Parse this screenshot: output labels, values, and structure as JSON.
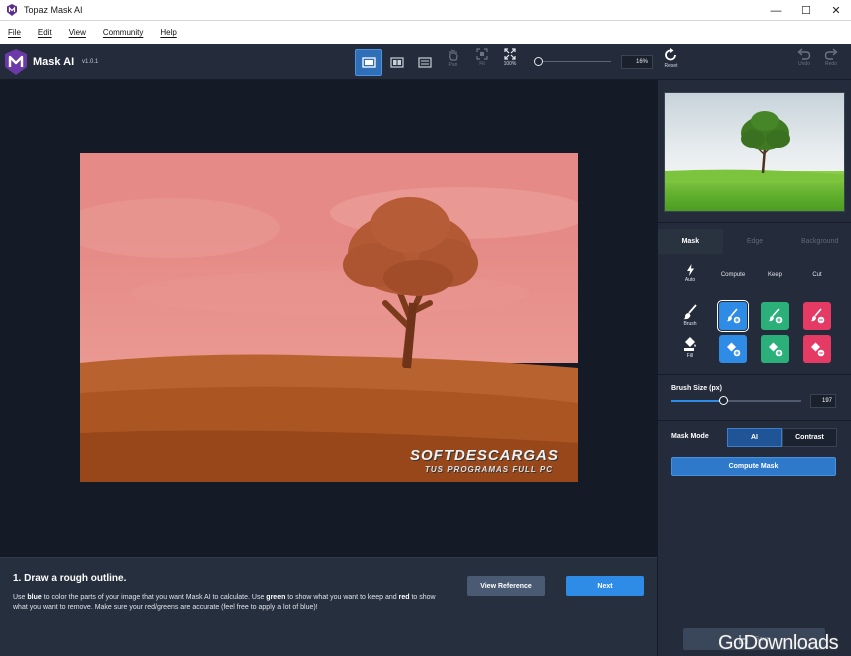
{
  "window": {
    "title": "Topaz Mask AI",
    "minimize": "—",
    "maximize": "☐",
    "close": "✕"
  },
  "menu": {
    "items": [
      "File",
      "Edit",
      "View",
      "Community",
      "Help"
    ]
  },
  "toolbar": {
    "app_name": "Mask AI",
    "version": "v1.0.1",
    "pan_label": "Pan",
    "fit_label": "Fit",
    "zoom100_label": "100%",
    "zoom_value": "16%",
    "zoom_fraction": 0.0,
    "reset_label": "Reset",
    "undo_label": "Undo",
    "redo_label": "Redo"
  },
  "canvas": {
    "watermark_title": "SOFTDESCARGAS",
    "watermark_subtitle": "TUS PROGRAMAS FULL PC"
  },
  "instructions": {
    "heading": "1. Draw a rough outline.",
    "text_1": "Use ",
    "blue": "blue",
    "text_2": " to color the parts of your image that you want Mask AI to calculate. Use ",
    "green": "green",
    "text_3": " to show what you want to keep and ",
    "red": "red",
    "text_4": " to show what you want to remove. Make sure your red/greens are accurate (feel free to apply a lot of blue)!",
    "view_reference": "View Reference",
    "next": "Next"
  },
  "panel": {
    "tabs": [
      "Mask",
      "Edge",
      "Background"
    ],
    "auto_label": "Auto",
    "compute_label": "Compute",
    "keep_label": "Keep",
    "cut_label": "Cut",
    "brush_label": "Brush",
    "fill_label": "Fill",
    "brush_size_label": "Brush Size (px)",
    "brush_size_value": "197",
    "mask_mode_label": "Mask Mode",
    "mode_ai": "AI",
    "mode_contrast": "Contrast",
    "compute_mask": "Compute Mask",
    "save": "Save"
  },
  "overlay": {
    "watermark": "GoDownloads"
  },
  "colors": {
    "accent_blue": "#2e8be6",
    "keep_green": "#2bb07a",
    "cut_red": "#e43a64",
    "mask_overlay": "#e58a86"
  }
}
